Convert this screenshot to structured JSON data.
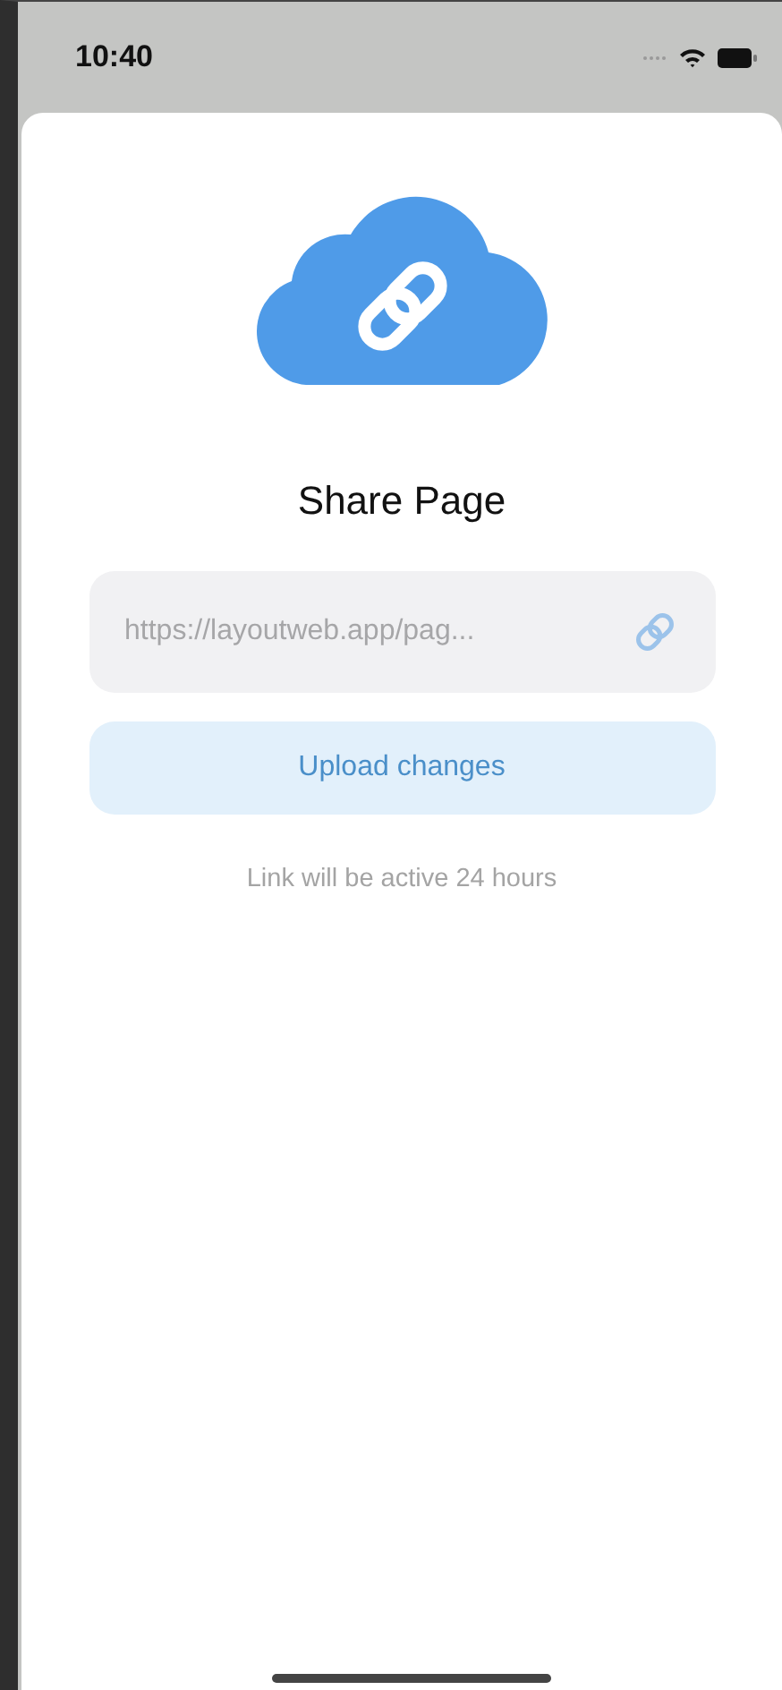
{
  "status_bar": {
    "time": "10:40"
  },
  "sheet": {
    "title": "Share Page",
    "link_field": {
      "value": "https://layoutweb.app/pag..."
    },
    "upload_button": "Upload changes",
    "note": "Link will be active 24 hours"
  }
}
